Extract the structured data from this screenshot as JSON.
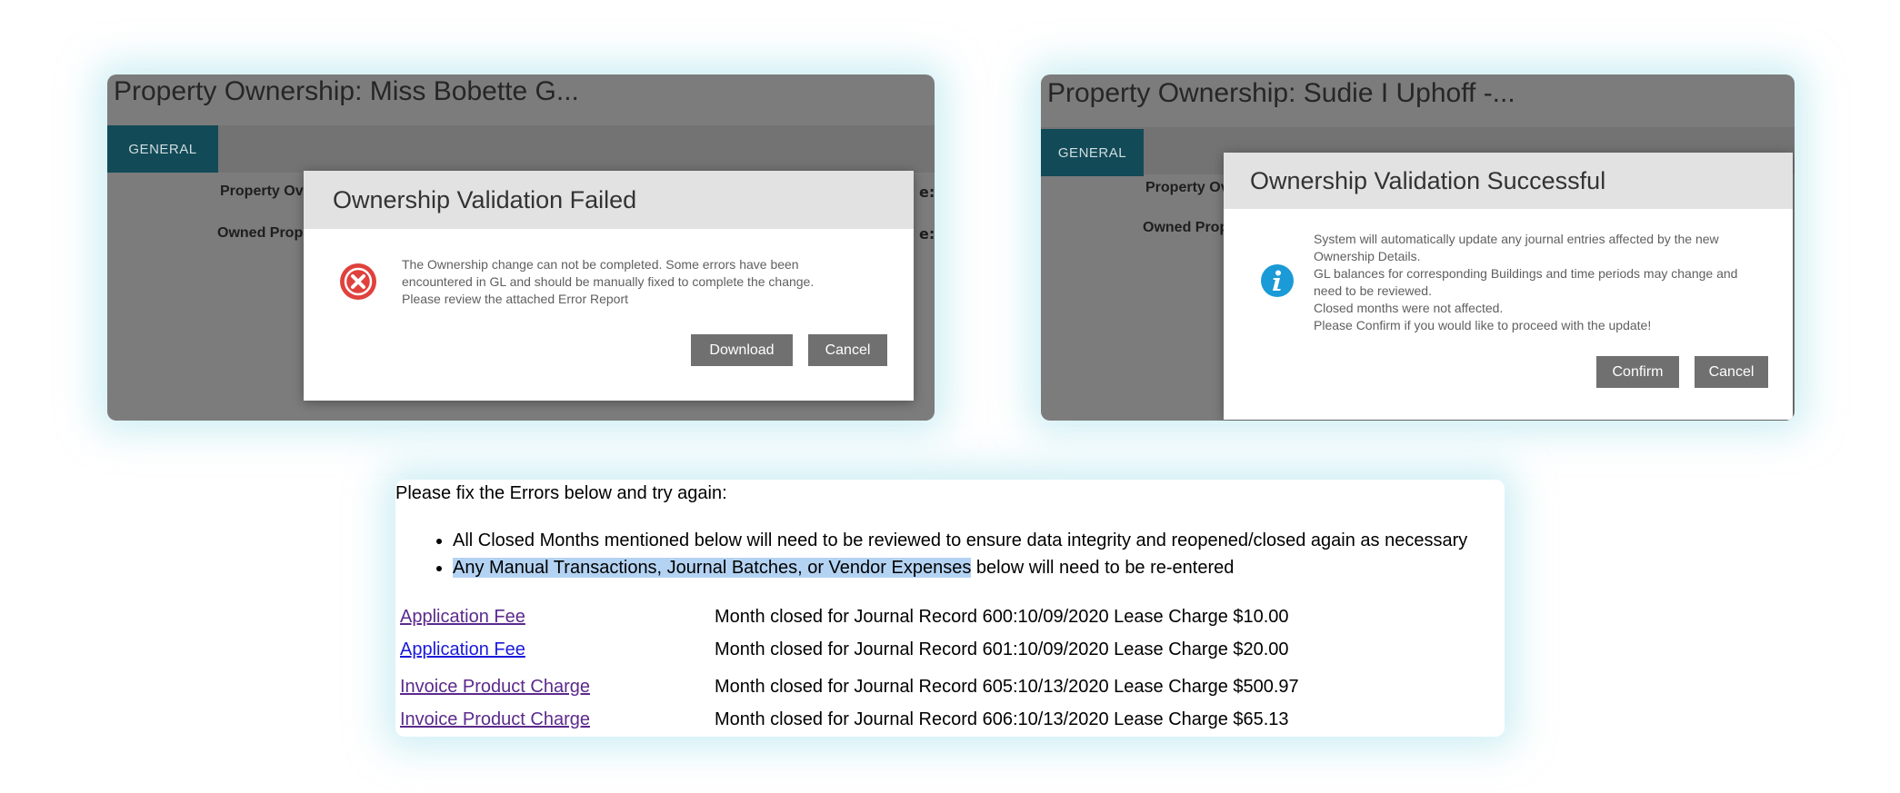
{
  "left_panel": {
    "title": "Property Ownership: Miss Bobette G...",
    "tab": "GENERAL",
    "labels": [
      "Property Ov",
      "Owned Prop"
    ],
    "edge_labels": [
      "e:",
      "e:"
    ]
  },
  "right_panel": {
    "title": "Property Ownership: Sudie I Uphoff -...",
    "tab": "GENERAL",
    "labels": [
      "Property Ov",
      "Owned Prop"
    ]
  },
  "dialog_failed": {
    "title": "Ownership Validation Failed",
    "icon": "error-x-icon",
    "message_lines": [
      "The Ownership change can not be completed. Some errors have been",
      "encountered in GL and should be manually fixed to complete the change.",
      "Please review the attached Error Report"
    ],
    "buttons": {
      "download": "Download",
      "cancel": "Cancel"
    }
  },
  "dialog_success": {
    "title": "Ownership Validation Successful",
    "icon": "info-icon",
    "message_lines": [
      "System will automatically update any journal entries affected by the new",
      "Ownership Details.",
      "GL balances for corresponding Buildings and time periods may change and",
      "need to be reviewed.",
      "Closed months were not affected.",
      "Please Confirm if you would like to proceed with the update!"
    ],
    "buttons": {
      "confirm": "Confirm",
      "cancel": "Cancel"
    }
  },
  "report": {
    "intro": "Please fix the Errors below and try again:",
    "bullet_1": "All Closed Months mentioned below will need to be reviewed to ensure data integrity and reopened/closed again as necessary",
    "bullet_2_highlighted": "Any Manual Transactions, Journal Batches, or Vendor Expenses",
    "bullet_2_rest": " below will need to be re-entered",
    "rows": [
      {
        "link": "Application Fee",
        "desc": "Month closed for Journal Record 600:10/09/2020 Lease Charge $10.00",
        "visited": true
      },
      {
        "link": "Application Fee",
        "desc": "Month closed for Journal Record 601:10/09/2020 Lease Charge $20.00",
        "visited": false
      },
      {
        "link": "Invoice Product Charge",
        "desc": "Month closed for Journal Record 605:10/13/2020 Lease Charge $500.97",
        "visited": true
      },
      {
        "link": "Invoice Product Charge",
        "desc": "Month closed for Journal Record 606:10/13/2020 Lease Charge $65.13",
        "visited": true
      }
    ]
  },
  "colors": {
    "panel_bg": "#7c7c7c",
    "tab_active": "#134a57",
    "button_bg": "#707070",
    "error_icon": "#e0413c",
    "info_icon": "#1a9ad6",
    "link_visited": "#5b2a8c",
    "link_unvisited": "#1a1adb",
    "selection_highlight": "#b4d3f3"
  }
}
